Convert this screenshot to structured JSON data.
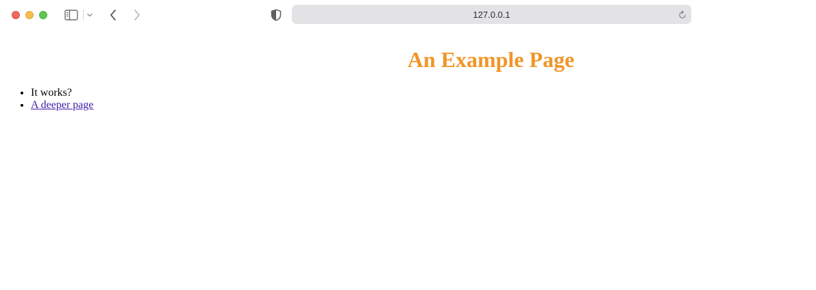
{
  "browser": {
    "url": "127.0.0.1",
    "icons": {
      "close": "close-window-icon",
      "minimize": "minimize-window-icon",
      "maximize": "maximize-window-icon",
      "sidebar": "sidebar-icon",
      "sidebar_menu": "chevron-down-icon",
      "back": "chevron-left-icon",
      "forward": "chevron-right-icon",
      "privacy": "shield-icon",
      "reload": "reload-icon"
    },
    "colors": {
      "close": "#ed6a5e",
      "minimize": "#f4bf4f",
      "maximize": "#61c554",
      "address_bar_bg": "#e3e3e6"
    }
  },
  "page": {
    "title": "An Example Page",
    "title_color": "#f0962a",
    "items": [
      {
        "text": "It works?"
      },
      {
        "text": "A deeper page",
        "is_link": true
      }
    ],
    "link_color": "#3c1ea8"
  }
}
